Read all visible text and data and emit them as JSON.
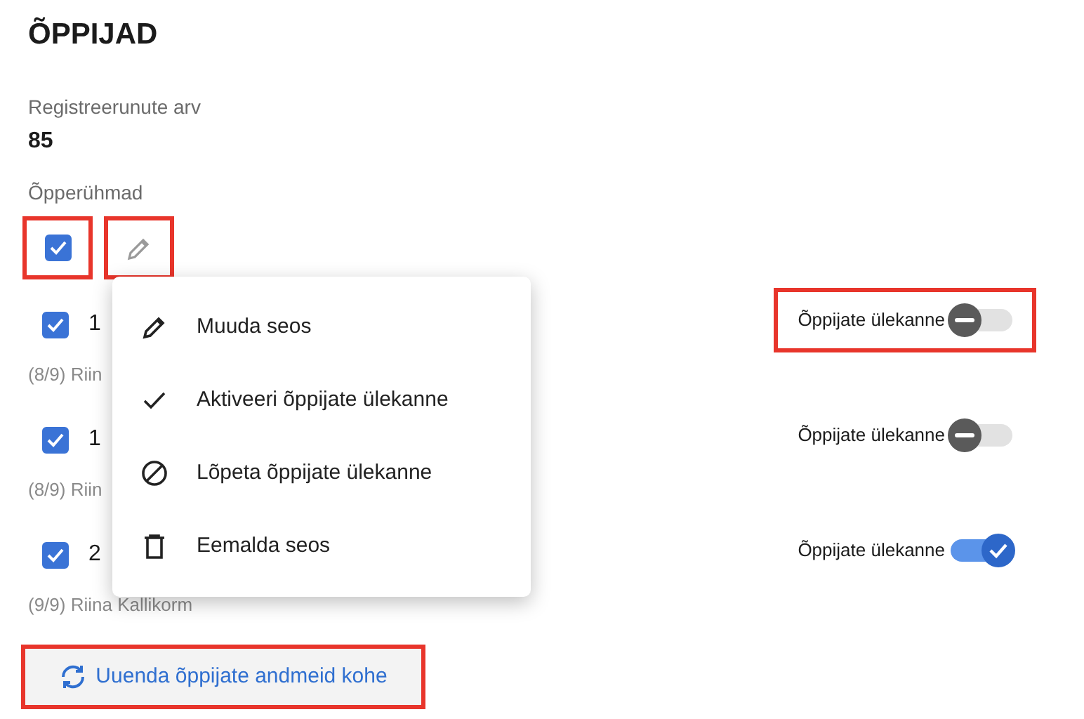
{
  "title": "ÕPPIJAD",
  "registered": {
    "label": "Registreerunute arv",
    "value": "85"
  },
  "groups_label": "Õpperühmad",
  "toolbar": {
    "select_all": {
      "checked": true,
      "highlighted": true
    },
    "edit": {
      "highlighted": true
    }
  },
  "groups": [
    {
      "name": "1",
      "subtitle": "(8/9) Riin",
      "checked": true,
      "transfer": {
        "label": "Õppijate ülekanne",
        "on": false,
        "highlighted": true
      }
    },
    {
      "name": "1",
      "subtitle": "(8/9) Riin",
      "checked": true,
      "transfer": {
        "label": "Õppijate ülekanne",
        "on": false,
        "highlighted": false
      }
    },
    {
      "name": "2",
      "subtitle": "(9/9) Riina Kallikorm",
      "checked": true,
      "transfer": {
        "label": "Õppijate ülekanne",
        "on": true,
        "highlighted": false
      }
    }
  ],
  "menu": [
    {
      "kind": "edit",
      "label": "Muuda seos"
    },
    {
      "kind": "activate",
      "label": "Aktiveeri õppijate ülekanne"
    },
    {
      "kind": "stop",
      "label": "Lõpeta õppijate ülekanne"
    },
    {
      "kind": "delete",
      "label": "Eemalda seos"
    }
  ],
  "refresh_button": {
    "label": "Uuenda õppijate andmeid kohe",
    "highlighted": true
  }
}
